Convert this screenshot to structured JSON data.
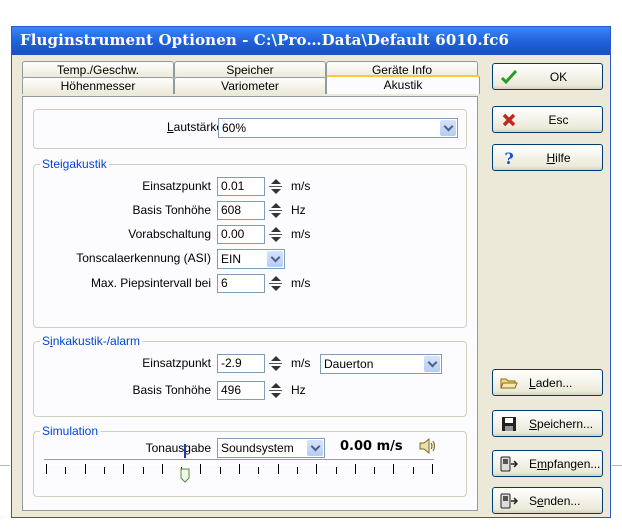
{
  "window": {
    "title": "Fluginstrument Optionen - C:\\Pro…Data\\Default 6010.fc6"
  },
  "tabs": {
    "row1": [
      "Temp./Geschw.",
      "Speicher",
      "Geräte Info"
    ],
    "row2": [
      "Höhenmesser",
      "Variometer",
      "Akustik"
    ],
    "active": "Akustik"
  },
  "lautstaerke": {
    "label_pre": "",
    "label_u": "L",
    "label_post": "autstärke",
    "value": "60%"
  },
  "steigakustik": {
    "legend": "Steigakustik",
    "einsatzpunkt": {
      "label": "Einsatzpunkt",
      "value": "0.01",
      "unit": "m/s"
    },
    "basis_tonhoehe": {
      "label": "Basis Tonhöhe",
      "value": "608",
      "unit": "Hz"
    },
    "vorabschaltung": {
      "label": "Vorabschaltung",
      "value": "0.00",
      "unit": "m/s"
    },
    "tonscala": {
      "label": "Tonscalaerkennung (ASI)",
      "value": "EIN"
    },
    "max_piepsintervall": {
      "label": "Max. Piepsintervall bei",
      "value": "6",
      "unit": "m/s"
    }
  },
  "sinkakustik": {
    "legend_pre": "S",
    "legend_u": "i",
    "legend_post": "nkakustik-/alarm",
    "einsatzpunkt": {
      "label": "Einsatzpunkt",
      "value": "-2.9",
      "unit": "m/s"
    },
    "mode": "Dauerton",
    "basis_tonhoehe": {
      "label": "Basis Tonhöhe",
      "value": "496",
      "unit": "Hz"
    }
  },
  "simulation": {
    "legend": "Simulation",
    "tonausgabe": {
      "label": "Tonausgabe",
      "value": "Soundsystem"
    },
    "readout": "0.00 m/s",
    "slider_position": 0.36
  },
  "buttons": {
    "ok": "OK",
    "esc": "Esc",
    "hilfe_u": "H",
    "hilfe_rest": "ilfe",
    "laden_u": "L",
    "laden_rest": "aden...",
    "speichern_u": "S",
    "speichern_rest": "peichern...",
    "empfangen_pre": "E",
    "empfangen_u": "m",
    "empfangen_rest": "pfangen...",
    "senden_pre": "S",
    "senden_u": "e",
    "senden_rest": "nden..."
  },
  "colors": {
    "title_bar": "#1f5fd9",
    "legend_text": "#0046d5",
    "active_tab_accent": "#ffc83c"
  }
}
